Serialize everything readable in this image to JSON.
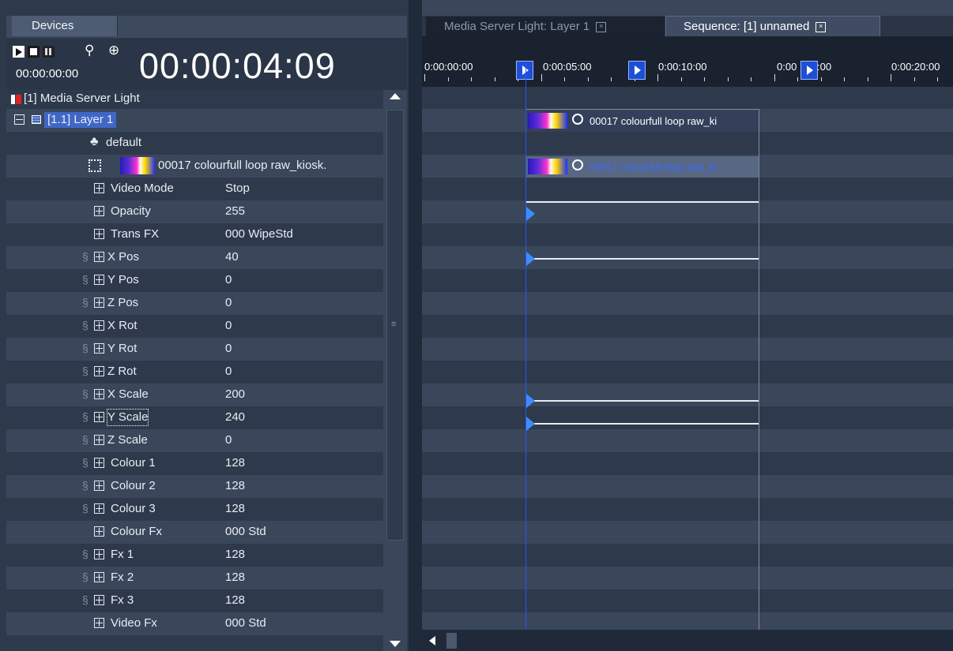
{
  "left_panel": {
    "tab_label": "Devices",
    "small_time": "00:00:00:00",
    "big_time": "00:00:04:09",
    "device_label": "[1] Media Server Light",
    "rows": [
      {
        "name": "layer",
        "label": "[1.1] Layer 1"
      },
      {
        "name": "default",
        "label": "default"
      },
      {
        "name": "media-clip",
        "label": "00017 colourfull loop raw_kiosk."
      },
      {
        "name": "video-mode",
        "label": "Video Mode",
        "value": "Stop"
      },
      {
        "name": "opacity",
        "label": "Opacity",
        "value": "255"
      },
      {
        "name": "trans-fx",
        "label": "Trans FX",
        "value": "000 WipeStd"
      },
      {
        "name": "x-pos",
        "label": "X Pos",
        "value": "40"
      },
      {
        "name": "y-pos",
        "label": "Y Pos",
        "value": "0"
      },
      {
        "name": "z-pos",
        "label": "Z Pos",
        "value": "0"
      },
      {
        "name": "x-rot",
        "label": "X Rot",
        "value": "0"
      },
      {
        "name": "y-rot",
        "label": "Y Rot",
        "value": "0"
      },
      {
        "name": "z-rot",
        "label": "Z Rot",
        "value": "0"
      },
      {
        "name": "x-scale",
        "label": "X Scale",
        "value": "200"
      },
      {
        "name": "y-scale",
        "label": "Y Scale",
        "value": "240"
      },
      {
        "name": "z-scale",
        "label": "Z Scale",
        "value": "0"
      },
      {
        "name": "colour-1",
        "label": "Colour 1",
        "value": "128"
      },
      {
        "name": "colour-2",
        "label": "Colour 2",
        "value": "128"
      },
      {
        "name": "colour-3",
        "label": "Colour 3",
        "value": "128"
      },
      {
        "name": "colour-fx",
        "label": "Colour Fx",
        "value": "000 Std"
      },
      {
        "name": "fx-1",
        "label": "Fx 1",
        "value": "128"
      },
      {
        "name": "fx-2",
        "label": "Fx 2",
        "value": "128"
      },
      {
        "name": "fx-3",
        "label": "Fx 3",
        "value": "128"
      },
      {
        "name": "video-fx",
        "label": "Video Fx",
        "value": "000 Std"
      }
    ]
  },
  "right_panel": {
    "tab_media": "Media Server Light: Layer 1",
    "tab_sequence": "Sequence: [1] unnamed",
    "ruler_labels": [
      "0:00:00:00",
      "0:00:05:00",
      "0:00:10:00",
      "0:00",
      ":00",
      "0:00:20:00"
    ],
    "clip_label_1": "00017 colourfull loop raw_ki",
    "clip_label_2": "00017 colourfull loop raw_ki"
  },
  "colors": {
    "selection": "#3f67c8",
    "marker": "#1d4fd6",
    "playhead": "#1f56ff"
  }
}
